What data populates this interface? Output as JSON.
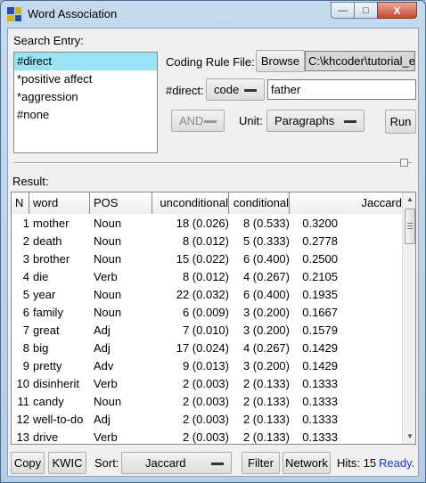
{
  "window": {
    "title": "Word Association",
    "min_label": "—",
    "max_label": "□",
    "close_label": "X"
  },
  "search": {
    "label": "Search Entry:",
    "entries": [
      "#direct",
      "*positive affect",
      "*aggression",
      "#none"
    ],
    "selected_index": 0
  },
  "coding": {
    "rule_file_label": "Coding Rule File:",
    "browse_label": "Browse",
    "rule_file_path": "C:\\khcoder\\tutorial_e",
    "code_row_label": "#direct:",
    "code_type": "code",
    "code_value": "father",
    "operator": "AND",
    "unit_label": "Unit:",
    "unit": "Paragraphs",
    "run_label": "Run"
  },
  "result": {
    "label": "Result:",
    "columns": [
      "N",
      "word",
      "POS",
      "unconditional",
      "conditional",
      "Jaccard"
    ],
    "rows": [
      [
        "1",
        "mother",
        "Noun",
        "18 (0.026)",
        "8 (0.533)",
        "0.3200"
      ],
      [
        "2",
        "death",
        "Noun",
        "8 (0.012)",
        "5 (0.333)",
        "0.2778"
      ],
      [
        "3",
        "brother",
        "Noun",
        "15 (0.022)",
        "6 (0.400)",
        "0.2500"
      ],
      [
        "4",
        "die",
        "Verb",
        "8 (0.012)",
        "4 (0.267)",
        "0.2105"
      ],
      [
        "5",
        "year",
        "Noun",
        "22 (0.032)",
        "6 (0.400)",
        "0.1935"
      ],
      [
        "6",
        "family",
        "Noun",
        "6 (0.009)",
        "3 (0.200)",
        "0.1667"
      ],
      [
        "7",
        "great",
        "Adj",
        "7 (0.010)",
        "3 (0.200)",
        "0.1579"
      ],
      [
        "8",
        "big",
        "Adj",
        "17 (0.024)",
        "4 (0.267)",
        "0.1429"
      ],
      [
        "9",
        "pretty",
        "Adv",
        "9 (0.013)",
        "3 (0.200)",
        "0.1429"
      ],
      [
        "10",
        "disinherit",
        "Verb",
        "2 (0.003)",
        "2 (0.133)",
        "0.1333"
      ],
      [
        "11",
        "candy",
        "Noun",
        "2 (0.003)",
        "2 (0.133)",
        "0.1333"
      ],
      [
        "12",
        "well-to-do",
        "Adj",
        "2 (0.003)",
        "2 (0.133)",
        "0.1333"
      ],
      [
        "13",
        "drive",
        "Verb",
        "2 (0.003)",
        "2 (0.133)",
        "0.1333"
      ]
    ]
  },
  "footer": {
    "copy_label": "Copy",
    "kwic_label": "KWIC",
    "sort_label": "Sort:",
    "sort_value": "Jaccard",
    "filter_label": "Filter",
    "network_label": "Network",
    "hits_text": "Hits: 15",
    "status": "Ready."
  },
  "colors": {
    "selected_row": "#99e4f4",
    "status_ready": "#1a3cc8",
    "close_button": "#c7492e"
  }
}
